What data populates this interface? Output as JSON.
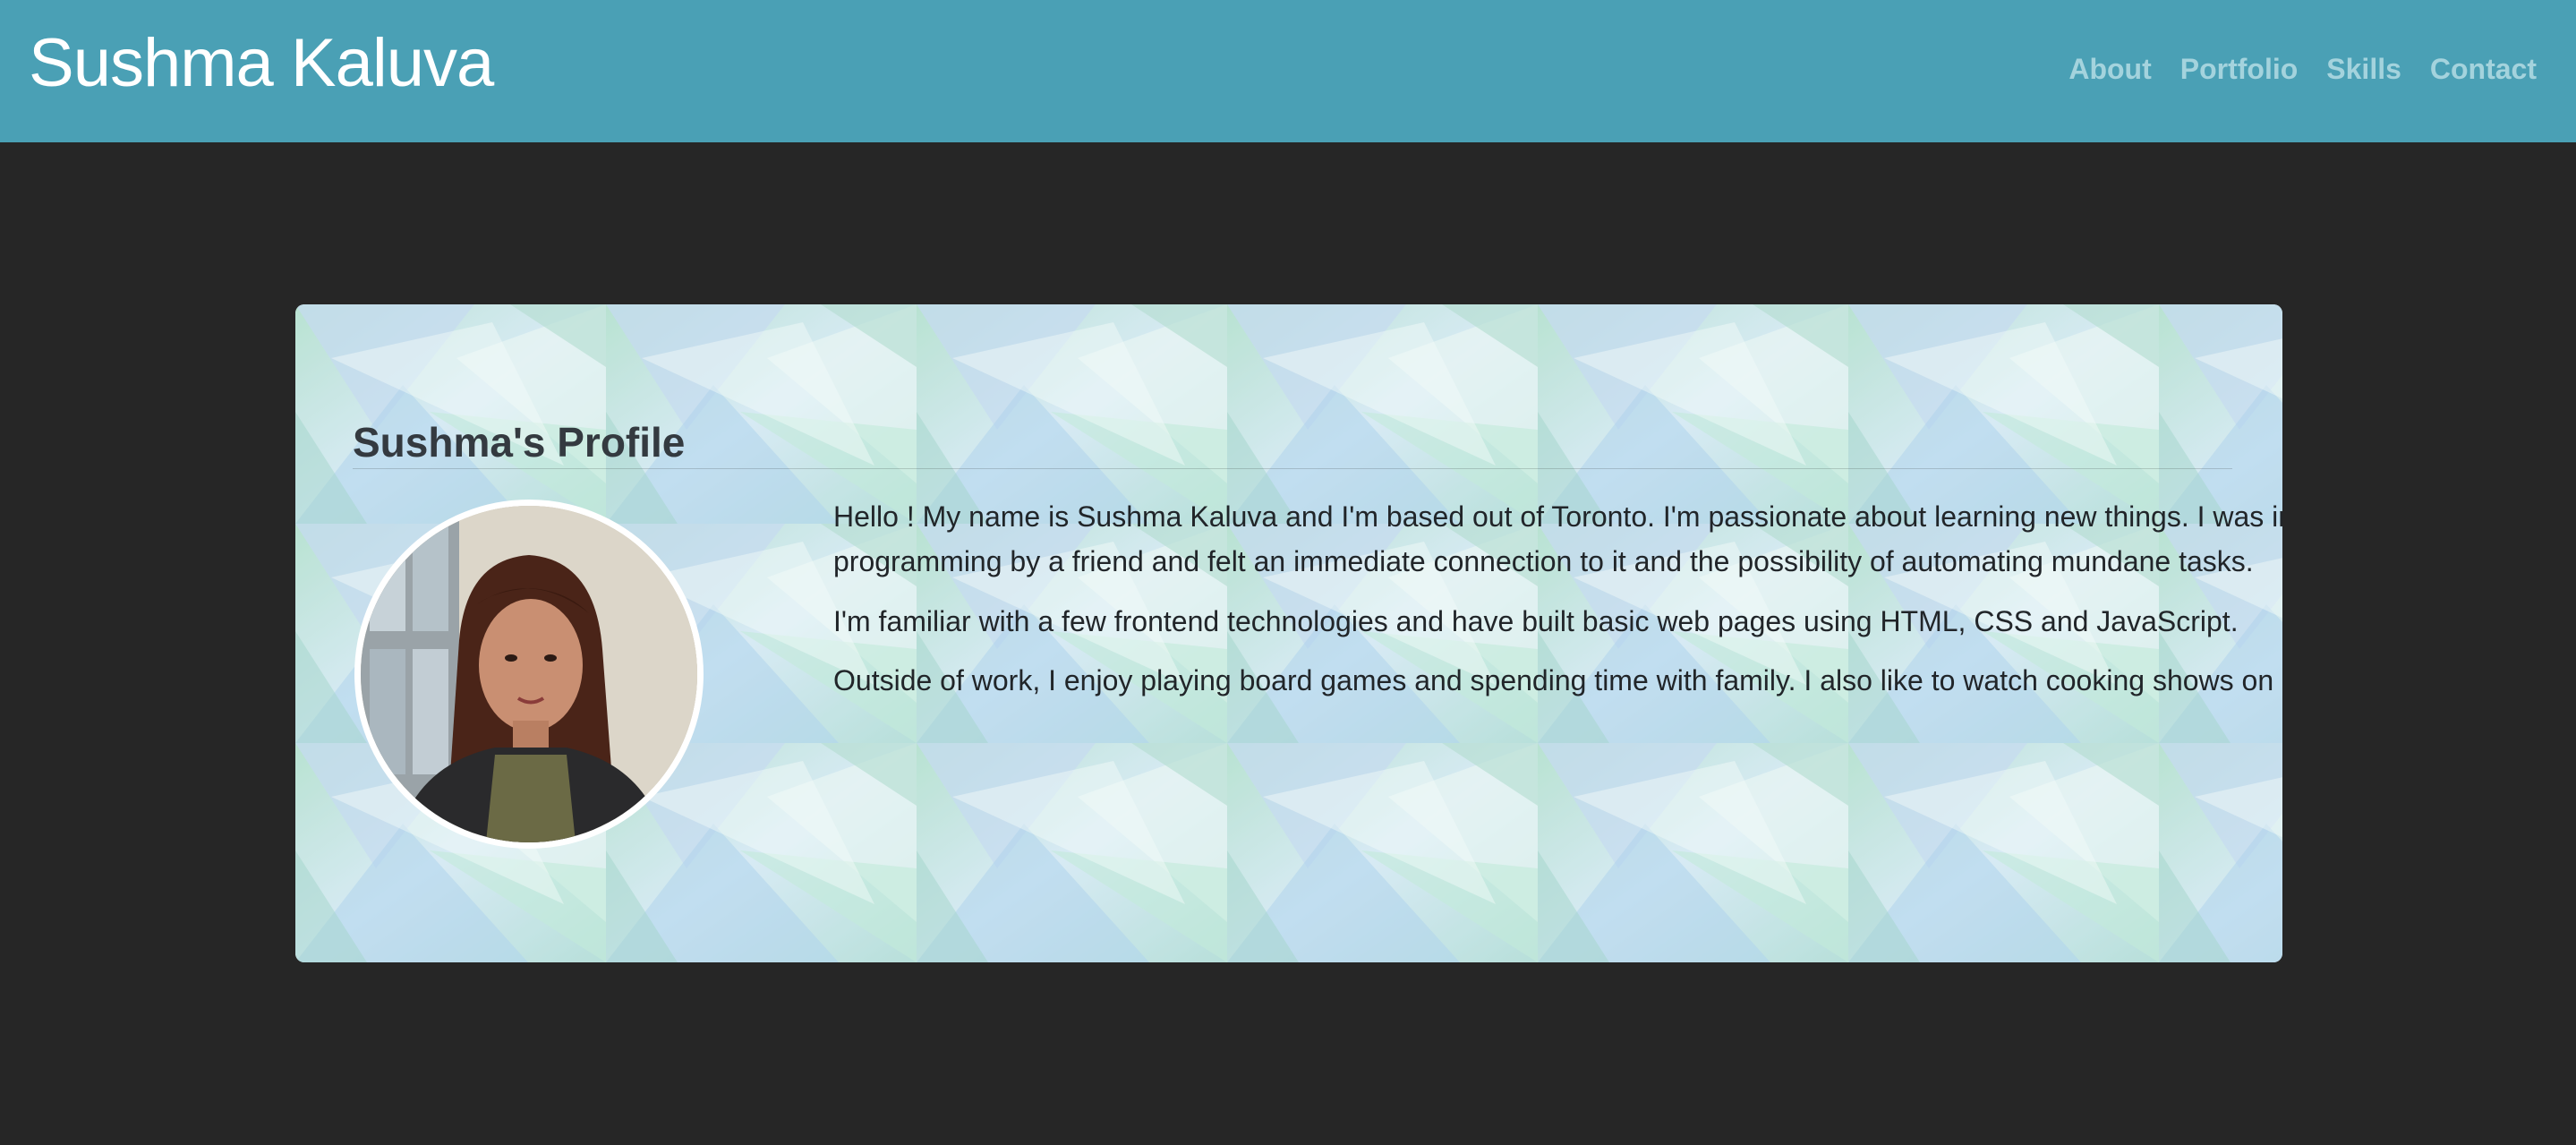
{
  "header": {
    "brand": "Sushma Kaluva",
    "nav": [
      "About",
      "Portfolio",
      "Skills",
      "Contact"
    ]
  },
  "profile": {
    "title": "Sushma's Profile",
    "paragraphs": [
      "Hello ! My name is Sushma Kaluva and I'm based out of Toronto. I'm passionate about learning new things. I was introduced to programming by a friend and felt an immediate connection to it and the possibility of automating mundane tasks.",
      "I'm familiar with a few frontend technologies and have built basic web pages using HTML, CSS and JavaScript.",
      "Outside of work, I enjoy playing board games and spending time with family. I also like to watch cooking shows on Netflix."
    ]
  },
  "colors": {
    "navbar": "#4aa0b5",
    "page_background": "#262626",
    "nav_link": "#a4d3dd",
    "brand_text": "#ffffff"
  }
}
